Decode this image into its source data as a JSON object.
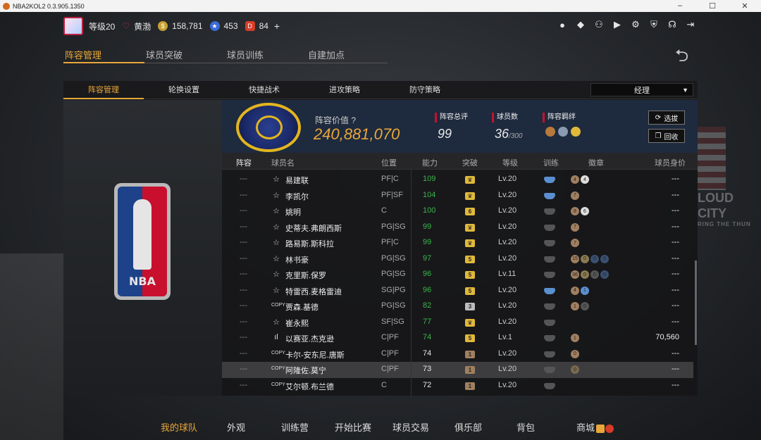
{
  "window": {
    "title": "NBA2KOL2 0.3.905.1350"
  },
  "topbar": {
    "level": "等级20",
    "username": "黄渤",
    "gold": "158,781",
    "stars": "453",
    "tickets": "84",
    "plus": "+"
  },
  "top_icons": [
    "user-icon",
    "bell-icon",
    "friends-icon",
    "video-icon",
    "settings-icon",
    "shield-icon",
    "headset-icon",
    "logout-icon"
  ],
  "primary_tabs": [
    {
      "label": "阵容管理",
      "active": true
    },
    {
      "label": "球员突破",
      "active": false
    },
    {
      "label": "球员训练",
      "active": false
    },
    {
      "label": "自建加点",
      "active": false
    }
  ],
  "secondary_tabs": [
    {
      "label": "阵容管理",
      "active": true
    },
    {
      "label": "轮换设置",
      "active": false
    },
    {
      "label": "快捷战术",
      "active": false
    },
    {
      "label": "进攻策略",
      "active": false
    },
    {
      "label": "防守策略",
      "active": false
    }
  ],
  "manager_select": {
    "value": "经理"
  },
  "team": {
    "value_label": "阵容价值",
    "value": "240,881,070",
    "rating_label": "阵容总评",
    "rating": "99",
    "count_label": "球员数",
    "count": "36",
    "count_max": "/300",
    "bond_label": "阵容羁绊",
    "btn_select": "选拔",
    "btn_recycle": "回收"
  },
  "table": {
    "headers": [
      "阵容",
      "球员名",
      "位置",
      "能力",
      "突破",
      "等级",
      "训练",
      "徽章",
      "球员身价"
    ],
    "rows": [
      {
        "lineup": "---",
        "icon": "☆",
        "name": "易建联",
        "pos": "PF|C",
        "ovr": "109",
        "ovr_color": "#3cb44b",
        "break": "♛",
        "break_color": "#e0b83a",
        "level": "Lv.20",
        "train_color": "#5a8fd0",
        "badges": [
          {
            "t": "4",
            "c": "#a07f60"
          },
          {
            "t": "4",
            "c": "#ddd"
          }
        ],
        "value": "---"
      },
      {
        "lineup": "---",
        "icon": "☆",
        "name": "李凯尔",
        "pos": "PF|SF",
        "ovr": "104",
        "ovr_color": "#3cb44b",
        "break": "♛",
        "break_color": "#e0b83a",
        "level": "Lv.20",
        "train_color": "#5a8fd0",
        "badges": [
          {
            "t": "7",
            "c": "#a07f60"
          }
        ],
        "value": "---"
      },
      {
        "lineup": "---",
        "icon": "☆",
        "name": "姚明",
        "pos": "C",
        "ovr": "100",
        "ovr_color": "#3cb44b",
        "break": "6",
        "break_color": "#e0b83a",
        "level": "Lv.20",
        "train_color": "#555",
        "badges": [
          {
            "t": "8",
            "c": "#a07f60"
          },
          {
            "t": "6",
            "c": "#ddd"
          }
        ],
        "value": "---"
      },
      {
        "lineup": "---",
        "icon": "☆",
        "name": "史蒂夫.弗朗西斯",
        "pos": "PG|SG",
        "ovr": "99",
        "ovr_color": "#3cb44b",
        "break": "♛",
        "break_color": "#e0b83a",
        "level": "Lv.20",
        "train_color": "#555",
        "badges": [
          {
            "t": "7",
            "c": "#a07f60"
          }
        ],
        "value": "---"
      },
      {
        "lineup": "---",
        "icon": "☆",
        "name": "路易斯.斯科拉",
        "pos": "PF|C",
        "ovr": "99",
        "ovr_color": "#3cb44b",
        "break": "♛",
        "break_color": "#e0b83a",
        "level": "Lv.20",
        "train_color": "#555",
        "badges": [
          {
            "t": "7",
            "c": "#a07f60"
          }
        ],
        "value": "---"
      },
      {
        "lineup": "---",
        "icon": "☆",
        "name": "林书豪",
        "pos": "PG|SG",
        "ovr": "97",
        "ovr_color": "#3cb44b",
        "break": "5",
        "break_color": "#e0b83a",
        "level": "Lv.20",
        "train_color": "#555",
        "badges": [
          {
            "t": "15",
            "c": "#a07f60"
          },
          {
            "t": "0",
            "c": "#8a7a50"
          },
          {
            "t": "0",
            "c": "#3a5070"
          },
          {
            "t": "0",
            "c": "#3a5070"
          }
        ],
        "value": "---"
      },
      {
        "lineup": "---",
        "icon": "☆",
        "name": "克里斯.保罗",
        "pos": "PG|SG",
        "ovr": "96",
        "ovr_color": "#3cb44b",
        "break": "5",
        "break_color": "#e0b83a",
        "level": "Lv.11",
        "train_color": "#555",
        "badges": [
          {
            "t": "36",
            "c": "#a07f60"
          },
          {
            "t": "0",
            "c": "#8a7a50"
          },
          {
            "t": "0",
            "c": "#555"
          },
          {
            "t": "0",
            "c": "#3a5070"
          }
        ],
        "value": "---"
      },
      {
        "lineup": "---",
        "icon": "☆",
        "name": "特雷西.麦格雷迪",
        "pos": "SG|PG",
        "ovr": "96",
        "ovr_color": "#3cb44b",
        "break": "5",
        "break_color": "#e0b83a",
        "level": "Lv.20",
        "train_color": "#5a8fd0",
        "badges": [
          {
            "t": "4",
            "c": "#a07f60"
          },
          {
            "t": "1",
            "c": "#5a8fd0"
          }
        ],
        "value": "---"
      },
      {
        "lineup": "---",
        "icon": "COPY",
        "name": "贾森.基德",
        "pos": "PG|SG",
        "ovr": "82",
        "ovr_color": "#3cb44b",
        "break": "3",
        "break_color": "#bbb",
        "level": "Lv.20",
        "train_color": "#555",
        "badges": [
          {
            "t": "1",
            "c": "#a07f60"
          },
          {
            "t": "0",
            "c": "#555"
          }
        ],
        "value": "---"
      },
      {
        "lineup": "---",
        "icon": "☆",
        "name": "崔永熙",
        "pos": "SF|SG",
        "ovr": "77",
        "ovr_color": "#3cb44b",
        "break": "♛",
        "break_color": "#e0b83a",
        "level": "Lv.20",
        "train_color": "#555",
        "badges": [],
        "value": "---"
      },
      {
        "lineup": "---",
        "icon": "ıl",
        "name": "以赛亚.杰克逊",
        "pos": "C|PF",
        "ovr": "74",
        "ovr_color": "#3cb44b",
        "break": "5",
        "break_color": "#e0b83a",
        "level": "Lv.1",
        "train_color": "#555",
        "badges": [
          {
            "t": "1",
            "c": "#a07f60"
          }
        ],
        "value": "70,560"
      },
      {
        "lineup": "---",
        "icon": "COPY",
        "name": "卡尔-安东尼.唐斯",
        "pos": "C|PF",
        "ovr": "74",
        "ovr_color": "#e8e8e8",
        "break": "1",
        "break_color": "#a07f60",
        "level": "Lv.20",
        "train_color": "#555",
        "badges": [
          {
            "t": "0",
            "c": "#a07f60"
          }
        ],
        "value": "---"
      },
      {
        "lineup": "---",
        "icon": "COPY",
        "name": "阿隆佐.莫宁",
        "pos": "C|PF",
        "ovr": "73",
        "ovr_color": "#e8e8e8",
        "break": "1",
        "break_color": "#a07f60",
        "level": "Lv.20",
        "train_color": "#555",
        "badges": [
          {
            "t": "0",
            "c": "#7a6a50"
          }
        ],
        "value": "---",
        "selected": true
      },
      {
        "lineup": "---",
        "icon": "COPY",
        "name": "艾尔顿.布兰德",
        "pos": "C",
        "ovr": "72",
        "ovr_color": "#e8e8e8",
        "break": "1",
        "break_color": "#a07f60",
        "level": "Lv.20",
        "train_color": "#555",
        "badges": [],
        "value": "---"
      }
    ]
  },
  "bottom_nav": [
    {
      "label": "我的球队",
      "active": true
    },
    {
      "label": "外观",
      "active": false
    },
    {
      "label": "训练营",
      "active": false
    },
    {
      "label": "开始比赛",
      "active": false
    },
    {
      "label": "球员交易",
      "active": false
    },
    {
      "label": "俱乐部",
      "active": false
    },
    {
      "label": "背包",
      "active": false
    },
    {
      "label": "商城",
      "active": false
    }
  ],
  "background": {
    "city_text": "LOUD CITY",
    "city_sub": "RING THE THUN"
  },
  "colors": {
    "accent": "#e9a73a",
    "green": "#3cb44b",
    "brand_red": "#c8102e"
  }
}
